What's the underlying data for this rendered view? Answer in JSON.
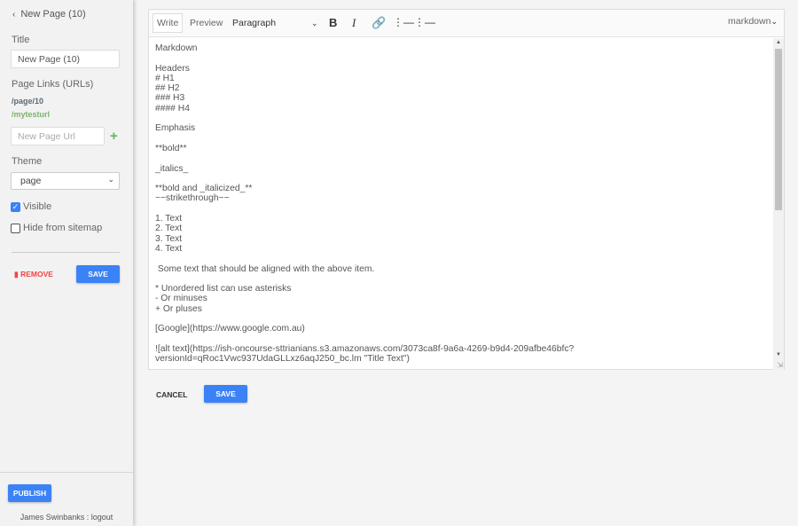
{
  "sidebar": {
    "back_label": "New Page (10)",
    "title_label": "Title",
    "title_value": "New Page  (10)",
    "links_label": "Page Links (URLs)",
    "links": [
      "/page/10",
      "/mytesturl"
    ],
    "new_url_placeholder": "New Page Url",
    "add_icon": "plus-icon",
    "theme_label": "Theme",
    "theme_value": "page",
    "visible_label": "Visible",
    "visible_checked": true,
    "hide_label": "Hide from sitemap",
    "hide_checked": false,
    "remove_label": "REMOVE",
    "save_label": "SAVE",
    "publish_label": "PUBLISH",
    "user_label": "James Swinbanks : logout"
  },
  "editor": {
    "write_tab": "Write",
    "preview_tab": "Preview",
    "format_value": "Paragraph",
    "mode_value": "markdown",
    "lines": [
      "Markdown",
      "",
      "Headers",
      "# H1",
      "## H2",
      "### H3",
      "#### H4",
      "",
      "Emphasis",
      "",
      "**bold**",
      "",
      "_italics_",
      "",
      "**bold and _italicized_**",
      "~~strikethrough~~",
      "",
      "1. Text",
      "2. Text",
      "3. Text",
      "4. Text",
      "",
      " Some text that should be aligned with the above item.",
      "",
      "* Unordered list can use asterisks",
      "- Or minuses",
      "+ Or pluses",
      "",
      "[Google](https://www.google.com.au)",
      "",
      "![alt text](https://ish-oncourse-sttrianians.s3.amazonaws.com/3073ca8f-9a6a-4269-b9d4-209afbe46bfc?",
      "versionId=qRoc1Vwc937UdaGLLxz6aqJ250_bc.lm \"Title Text\")"
    ],
    "cancel_label": "CANCEL",
    "save_label": "SAVE"
  },
  "colors": {
    "accent": "#3b82f6",
    "danger": "#ef4444",
    "link_green": "#7cb36a"
  }
}
